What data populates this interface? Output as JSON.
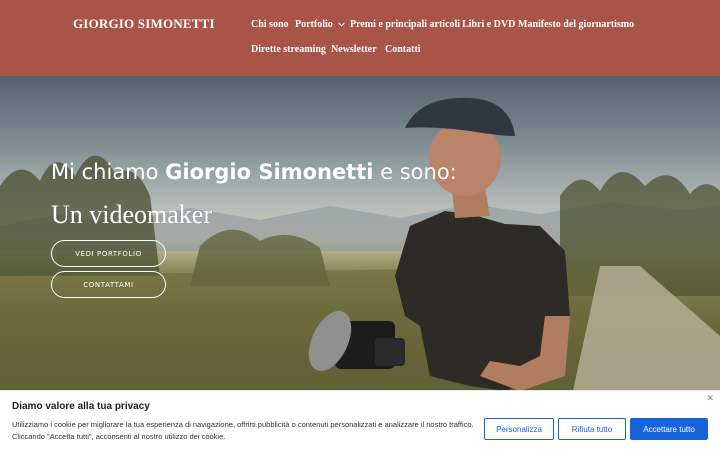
{
  "header": {
    "brand": "GIORGIO SIMONETTI",
    "nav": [
      {
        "label": "Chi sono"
      },
      {
        "label": "Portfolio"
      },
      {
        "label": "Premi e principali articoli"
      },
      {
        "label": "Libri e DVD"
      },
      {
        "label": "Manifesto del giornartismo"
      },
      {
        "label": "Dirette streaming"
      },
      {
        "label": "Newsletter"
      },
      {
        "label": "Contatti"
      }
    ],
    "bg_color": "#a85448"
  },
  "hero": {
    "intro_prefix": "Mi chiamo ",
    "intro_name": "Giorgio Simonetti",
    "intro_suffix": " e sono:",
    "role": "Un videomaker",
    "buttons": {
      "portfolio": "VEDI PORTFOLIO",
      "contact": "CONTATTAMI"
    }
  },
  "cookie_banner": {
    "title": "Diamo valore alla tua privacy",
    "text": "Utilizziamo i cookie per migliorare la tua esperienza di navigazione, offrirti pubblicità o contenuti personalizzati e analizzare il nostro traffico. Cliccando \"Accetta tutti\", acconsenti al nostro utilizzo dei cookie.",
    "close_icon": "close-icon",
    "buttons": {
      "customize": "Personalizza",
      "reject": "Rifiuta tutto",
      "accept": "Accettare tutto"
    },
    "accent_color": "#1863dc"
  }
}
